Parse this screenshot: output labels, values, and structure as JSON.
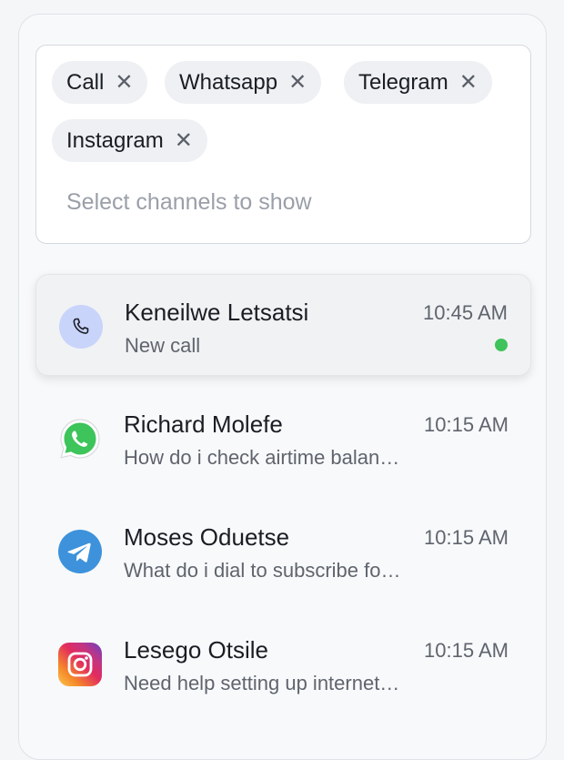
{
  "filter": {
    "chips": [
      {
        "label": "Call",
        "remove": "✕"
      },
      {
        "label": "Whatsapp",
        "remove": "✕"
      },
      {
        "label": "Telegram",
        "remove": "✕"
      },
      {
        "label": "Instagram",
        "remove": "✕"
      }
    ],
    "placeholder": "Select channels to show"
  },
  "conversations": [
    {
      "name": "Keneilwe Letsatsi",
      "preview": "New call",
      "time": "10:45 AM",
      "channel": "call-icon",
      "online": true
    },
    {
      "name": "Richard Molefe",
      "preview": "How do i check airtime balan…",
      "time": "10:15 AM",
      "channel": "whatsapp-icon"
    },
    {
      "name": "Moses Oduetse",
      "preview": "What do i dial to subscribe fo…",
      "time": "10:15 AM",
      "channel": "telegram-icon"
    },
    {
      "name": "Lesego Otsile",
      "preview": "Need help setting up internet…",
      "time": "10:15 AM",
      "channel": "instagram-icon"
    }
  ],
  "colors": {
    "online": "#3fc35a",
    "call_avatar_bg": "#c9d4fb",
    "whatsapp": "#3dc45a",
    "telegram": "#3d92db"
  }
}
